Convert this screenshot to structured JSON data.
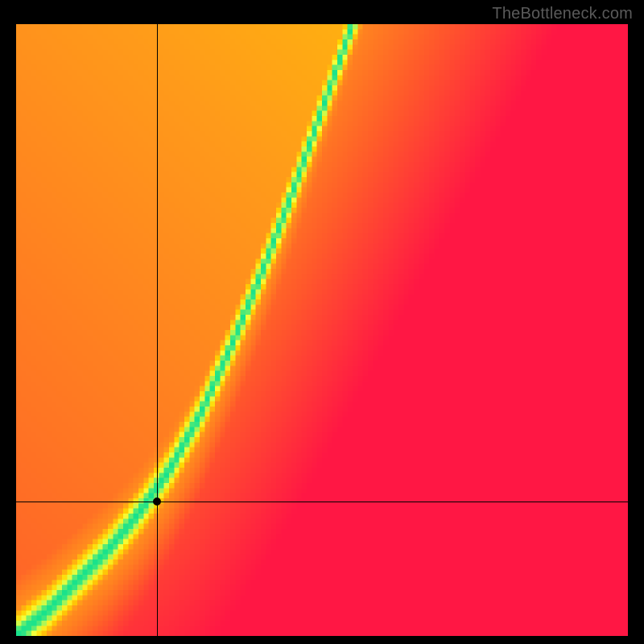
{
  "watermark": "TheBottleneck.com",
  "chart_data": {
    "type": "heatmap",
    "title": "",
    "xlabel": "",
    "ylabel": "",
    "xlim": [
      0,
      1
    ],
    "ylim": [
      0,
      1
    ],
    "grid_size": 120,
    "crosshair": {
      "x": 0.23,
      "y": 0.22
    },
    "marker": {
      "x": 0.23,
      "y": 0.22
    },
    "ridge": {
      "description": "Green optimal band (ridge) y as function of x; outside band value falls off toward red, with warmer plateau in upper-right",
      "points": [
        {
          "x": 0.0,
          "y": 0.0
        },
        {
          "x": 0.05,
          "y": 0.04
        },
        {
          "x": 0.1,
          "y": 0.09
        },
        {
          "x": 0.15,
          "y": 0.14
        },
        {
          "x": 0.2,
          "y": 0.2
        },
        {
          "x": 0.25,
          "y": 0.27
        },
        {
          "x": 0.3,
          "y": 0.36
        },
        {
          "x": 0.35,
          "y": 0.47
        },
        {
          "x": 0.4,
          "y": 0.59
        },
        {
          "x": 0.45,
          "y": 0.72
        },
        {
          "x": 0.5,
          "y": 0.86
        },
        {
          "x": 0.55,
          "y": 1.0
        }
      ],
      "band_halfwidth": 0.03
    },
    "colormap": {
      "stops": [
        {
          "t": 0.0,
          "color": "#ff1744"
        },
        {
          "t": 0.25,
          "color": "#ff5a2a"
        },
        {
          "t": 0.5,
          "color": "#ff9a1a"
        },
        {
          "t": 0.7,
          "color": "#ffd400"
        },
        {
          "t": 0.85,
          "color": "#f6ff3a"
        },
        {
          "t": 1.0,
          "color": "#18e28c"
        }
      ]
    }
  }
}
